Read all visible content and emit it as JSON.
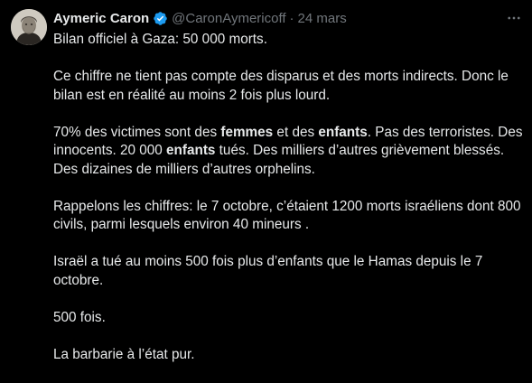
{
  "author": {
    "name": "Aymeric Caron",
    "handle": "@CaronAymericoff",
    "separator": "·",
    "date": "24 mars"
  },
  "icons": {
    "verified": "verified-badge-icon",
    "more": "more-options-icon",
    "avatar": "profile-avatar"
  },
  "colors": {
    "background": "#000000",
    "text": "#e7e9ea",
    "secondary": "#71767b",
    "verified": "#1d9bf0"
  },
  "tweet": {
    "p1": "Bilan officiel à Gaza: 50 000 morts.",
    "p2": "Ce chiffre ne tient pas compte des disparus et des morts indirects. Donc le bilan est en réalité au moins 2 fois plus lourd.",
    "p3": {
      "a": "70% des victimes sont des ",
      "b": "femmes",
      "c": " et des ",
      "d": "enfants",
      "e": ". Pas des terroristes. Des innocents. 20 000 ",
      "f": "enfants",
      "g": " tués. Des milliers d’autres grièvement blessés. Des dizaines de milliers d’autres orphelins."
    },
    "p4": "Rappelons les chiffres: le 7 octobre, c’étaient 1200 morts israéliens dont 800 civils, parmi lesquels environ 40 mineurs .",
    "p5": "Israël a tué au moins 500 fois plus d’enfants que le Hamas depuis le 7 octobre.",
    "p6": "500 fois.",
    "p7": "La barbarie à l’état pur."
  }
}
